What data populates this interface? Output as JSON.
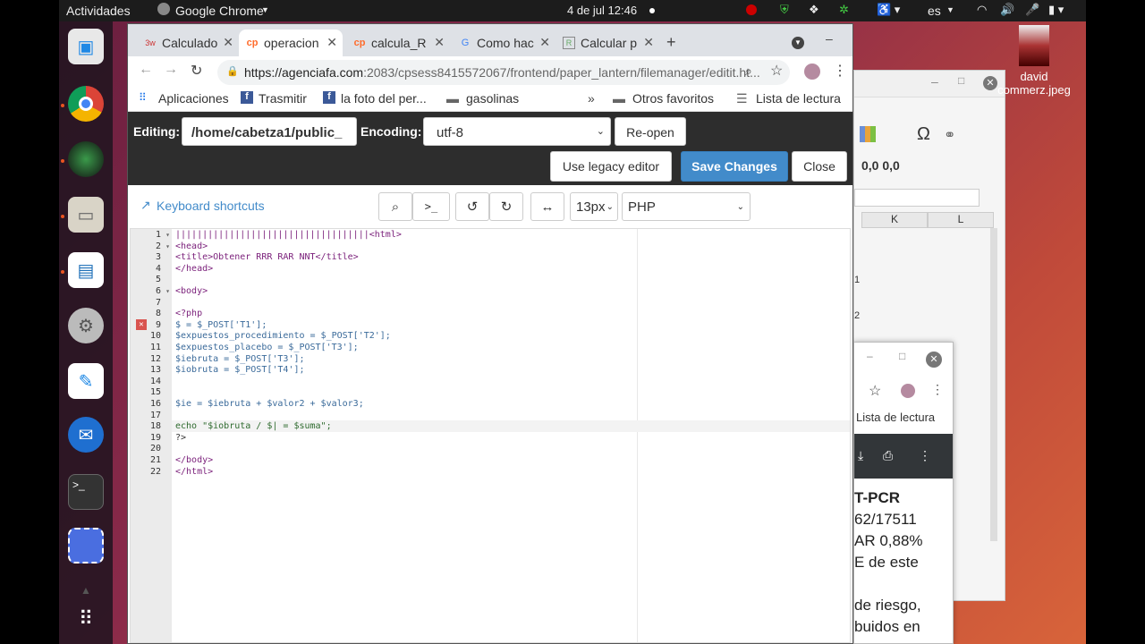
{
  "topbar": {
    "activities": "Actividades",
    "app": "Google Chrome",
    "clock": "4 de jul  12:46",
    "lang": "es"
  },
  "desktop": {
    "file_name_1": "david",
    "file_name_2": "commerz.jpeg"
  },
  "calc": {
    "col_k": "K",
    "col_l": "L",
    "cell_1": "1",
    "cell_2": "2"
  },
  "download_window": {
    "bookmark": "Lista de lectura",
    "text": [
      "T-PCR",
      "62/17511",
      "AR 0,88%",
      "E de este",
      "de riesgo,",
      "buidos en"
    ]
  },
  "tabs": [
    {
      "label": "Calculado",
      "favicon": "3w"
    },
    {
      "label": "operacion",
      "favicon": "cp"
    },
    {
      "label": "calcula_R",
      "favicon": "cp"
    },
    {
      "label": "Como hac",
      "favicon": "G"
    },
    {
      "label": "Calcular p",
      "favicon": "R"
    }
  ],
  "url": {
    "host": "https://agenciafa.com",
    "rest": ":2083/cpsess8415572067/frontend/paper_lantern/filemanager/editit.ht..."
  },
  "bookmarks": [
    "Aplicaciones",
    "Trasmitir",
    "la foto del per...",
    "gasolinas",
    "Otros favoritos",
    "Lista de lectura"
  ],
  "editor": {
    "editing_label": "Editing:",
    "path": "/home/cabetza1/public_",
    "encoding_label": "Encoding:",
    "encoding": "utf-8",
    "reopen": "Re-open",
    "legacy": "Use legacy editor",
    "save": "Save Changes",
    "close": "Close",
    "shortcuts": "Keyboard shortcuts",
    "font_size": "13px",
    "mode": "PHP"
  },
  "code": {
    "line_numbers": [
      "1",
      "2",
      "3",
      "4",
      "5",
      "6",
      "7",
      "8",
      "9",
      "10",
      "11",
      "12",
      "13",
      "14",
      "15",
      "16",
      "17",
      "18",
      "19",
      "20",
      "21",
      "22"
    ],
    "lines": [
      "||||||||||||||||||||||||||||||||||||<html>",
      "<head>",
      "<title>Obtener RRR RAR NNT</title>",
      "</head>",
      "",
      "<body>",
      "",
      "<?php",
      "$ = $_POST['T1'];",
      "$expuestos_procedimiento = $_POST['T2'];",
      "$expuestos_placebo = $_POST['T3'];",
      "$iebruta = $_POST['T3'];",
      "$iobruta = $_POST['T4'];",
      "",
      "",
      "$ie = $iebruta + $valor2 + $valor3;",
      "",
      "echo \"$iobruta / $| = $suma\";",
      "?>",
      "",
      "</body>",
      "</html>"
    ]
  }
}
